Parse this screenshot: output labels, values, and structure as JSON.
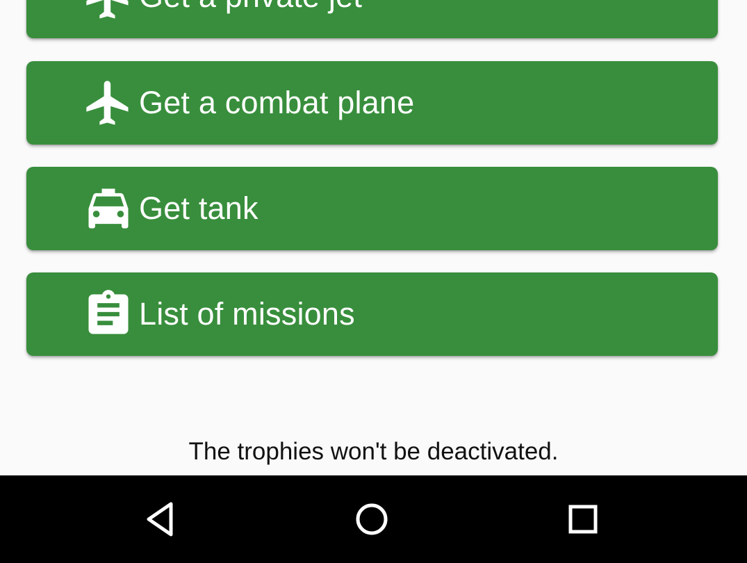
{
  "actions": [
    {
      "label": "Get a private jet",
      "icon": "airplane-icon"
    },
    {
      "label": "Get a combat plane",
      "icon": "airplane-icon"
    },
    {
      "label": "Get tank",
      "icon": "taxi-icon"
    },
    {
      "label": "List of missions",
      "icon": "clipboard-icon"
    }
  ],
  "footer": {
    "note": "The trophies won't be deactivated."
  },
  "navigation": {
    "back_icon": "back-triangle-icon",
    "home_icon": "home-circle-icon",
    "recents_icon": "recents-square-icon"
  },
  "colors": {
    "button_green": "#388e3c",
    "background": "#fafafa",
    "nav_bar": "#000000",
    "button_text": "#ffffff"
  }
}
